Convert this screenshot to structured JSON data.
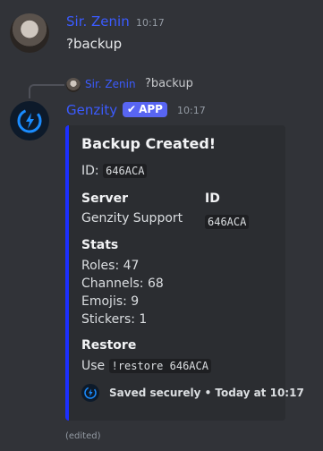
{
  "message1": {
    "author": "Sir. Zenin",
    "time": "10:17",
    "content": "?backup"
  },
  "reply": {
    "author": "Sir. Zenin",
    "content": "?backup"
  },
  "bot": {
    "name": "Genzity",
    "badge": "APP",
    "time": "10:17"
  },
  "embed": {
    "title": "Backup Created!",
    "id_label": "ID:",
    "id_value": "646ACA",
    "server_label": "Server",
    "server_value": "Genzity Support",
    "id_field_label": "ID",
    "id_field_value": "646ACA",
    "stats_label": "Stats",
    "stats": [
      "Roles: 47",
      "Channels: 68",
      "Emojis: 9",
      "Stickers: 1"
    ],
    "restore_label": "Restore",
    "restore_prefix": "Use",
    "restore_command": "!restore 646ACA",
    "footer": "Saved securely • Today at 10:17"
  },
  "edited": "(edited)",
  "colors": {
    "accent": "#1c2fff",
    "username": "#3b5bff",
    "badge": "#5865f2"
  }
}
